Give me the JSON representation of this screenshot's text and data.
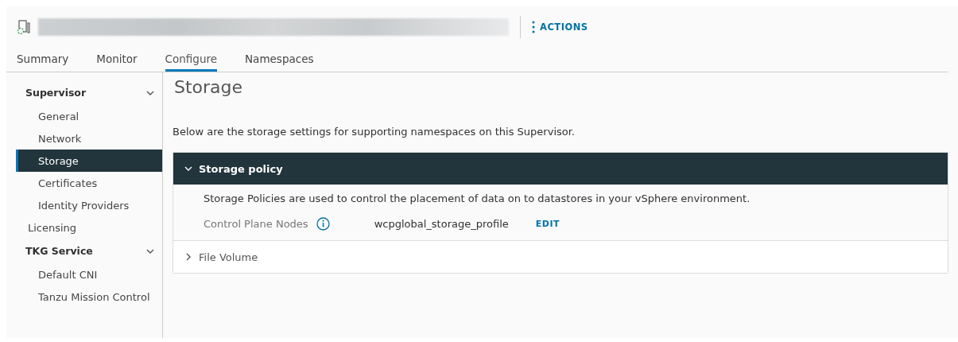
{
  "header": {
    "actions_label": "ACTIONS"
  },
  "tabs": [
    {
      "label": "Summary",
      "selected": false
    },
    {
      "label": "Monitor",
      "selected": false
    },
    {
      "label": "Configure",
      "selected": true
    },
    {
      "label": "Namespaces",
      "selected": false
    }
  ],
  "sidebar": {
    "items": [
      {
        "label": "Supervisor",
        "expanded": true,
        "children": [
          {
            "label": "General",
            "selected": false
          },
          {
            "label": "Network",
            "selected": false
          },
          {
            "label": "Storage",
            "selected": true
          },
          {
            "label": "Certificates",
            "selected": false
          },
          {
            "label": "Identity Providers",
            "selected": false
          }
        ]
      },
      {
        "label": "Licensing",
        "selected": false
      },
      {
        "label": "TKG Service",
        "expanded": true,
        "children": [
          {
            "label": "Default CNI",
            "selected": false
          },
          {
            "label": "Tanzu Mission Control",
            "selected": false
          }
        ]
      }
    ]
  },
  "content": {
    "title": "Storage",
    "description": "Below are the storage settings for supporting namespaces on this Supervisor.",
    "sections": [
      {
        "title": "Storage policy",
        "expanded": true,
        "text": "Storage Policies are used to control the placement of data on to datastores in your vSphere environment.",
        "field_label": "Control Plane Nodes",
        "field_value": "wcpglobal_storage_profile",
        "action": "EDIT"
      },
      {
        "title": "File Volume",
        "expanded": false
      }
    ]
  }
}
